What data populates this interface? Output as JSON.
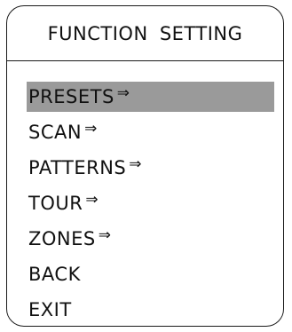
{
  "title": "FUNCTION  SETTING",
  "menu": {
    "selected_index": 0,
    "items": [
      {
        "label": "PRESETS",
        "arrow": "⇒"
      },
      {
        "label": "SCAN",
        "arrow": "⇒"
      },
      {
        "label": "PATTERNS",
        "arrow": "⇒"
      },
      {
        "label": "TOUR",
        "arrow": "⇒"
      },
      {
        "label": "ZONES",
        "arrow": "⇒"
      },
      {
        "label": "BACK",
        "arrow": ""
      },
      {
        "label": "EXIT",
        "arrow": ""
      }
    ]
  },
  "colors": {
    "selection_highlight": "#9a9a9a",
    "frame": "#1a1a1a"
  }
}
